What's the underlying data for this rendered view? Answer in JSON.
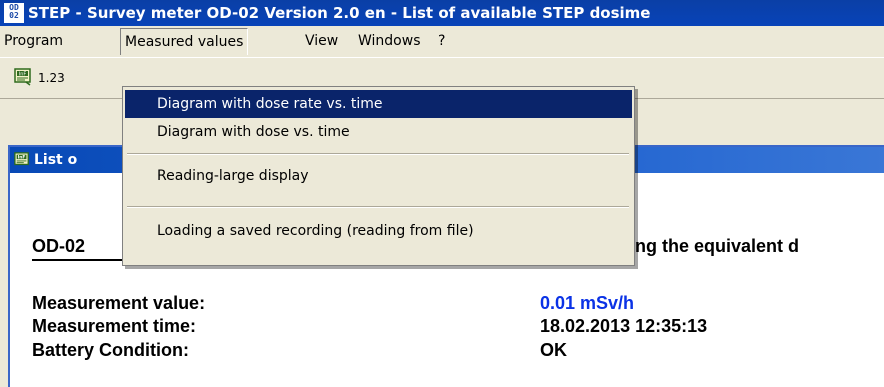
{
  "window": {
    "title": "STEP - Survey meter OD-02  Version 2.0 en - List of available STEP dosime",
    "app_icon_text_top": "OD",
    "app_icon_text_bottom": "02"
  },
  "menubar": {
    "items": [
      {
        "label": "Program"
      },
      {
        "label": "Measured values"
      },
      {
        "label": "View"
      },
      {
        "label": "Windows"
      },
      {
        "label": "?"
      }
    ]
  },
  "toolbar": {
    "info_button_icon": "info-icon",
    "partial_label": "1.23"
  },
  "child_window": {
    "title": "List o",
    "icon": "info-icon"
  },
  "dropdown": {
    "items": [
      {
        "label": "Diagram with dose rate vs. time",
        "highlighted": true
      },
      {
        "label": "Diagram with dose vs. time",
        "highlighted": false
      },
      {
        "label": "Reading-large display",
        "highlighted": false
      },
      {
        "label": "Loading a saved recording (reading from file)",
        "highlighted": false
      }
    ]
  },
  "content": {
    "heading_left": "OD-02",
    "heading_right": "ng the equivalent d",
    "rows": [
      {
        "label": "Measurement value:",
        "value": "0.01 mSv/h",
        "value_color": "#0a32e6"
      },
      {
        "label": "Measurement time:",
        "value": "18.02.2013 12:35:13",
        "value_color": "#000000"
      },
      {
        "label": "Battery Condition:",
        "value": "OK",
        "value_color": "#000000"
      }
    ]
  },
  "colors": {
    "titlebar": "#0843b8",
    "menu_highlight": "#0a246a",
    "value_blue": "#0a32e6"
  }
}
